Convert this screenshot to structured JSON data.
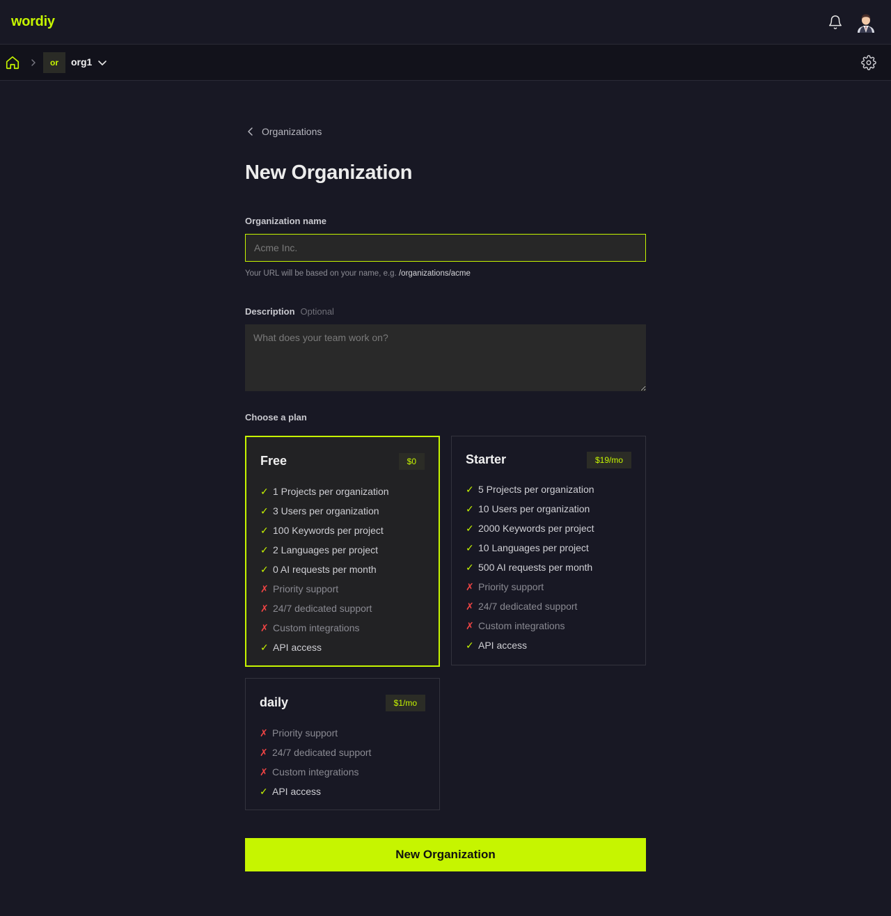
{
  "app": {
    "logo": "wordiy"
  },
  "breadcrumb": {
    "org_badge": "or",
    "org_name": "org1"
  },
  "back_link": "Organizations",
  "page_title": "New Organization",
  "form": {
    "name_label": "Organization name",
    "name_placeholder": "Acme Inc.",
    "name_value": "",
    "hint_prefix": "Your URL will be based on your name, e.g. ",
    "hint_example": "/organizations/acme",
    "description_label": "Description",
    "description_optional": "Optional",
    "description_placeholder": "What does your team work on?",
    "description_value": "",
    "plan_label": "Choose a plan"
  },
  "plans": [
    {
      "name": "Free",
      "price": "$0",
      "selected": true,
      "features": [
        {
          "text": "1 Projects per organization",
          "included": true
        },
        {
          "text": "3 Users per organization",
          "included": true
        },
        {
          "text": "100 Keywords per project",
          "included": true
        },
        {
          "text": "2 Languages per project",
          "included": true
        },
        {
          "text": "0 AI requests per month",
          "included": true
        },
        {
          "text": "Priority support",
          "included": false
        },
        {
          "text": "24/7 dedicated support",
          "included": false
        },
        {
          "text": "Custom integrations",
          "included": false
        },
        {
          "text": "API access",
          "included": true
        }
      ]
    },
    {
      "name": "Starter",
      "price": "$19/mo",
      "selected": false,
      "features": [
        {
          "text": "5 Projects per organization",
          "included": true
        },
        {
          "text": "10 Users per organization",
          "included": true
        },
        {
          "text": "2000 Keywords per project",
          "included": true
        },
        {
          "text": "10 Languages per project",
          "included": true
        },
        {
          "text": "500 AI requests per month",
          "included": true
        },
        {
          "text": "Priority support",
          "included": false
        },
        {
          "text": "24/7 dedicated support",
          "included": false
        },
        {
          "text": "Custom integrations",
          "included": false
        },
        {
          "text": "API access",
          "included": true
        }
      ]
    },
    {
      "name": "daily",
      "price": "$1/mo",
      "selected": false,
      "features": [
        {
          "text": "Priority support",
          "included": false
        },
        {
          "text": "24/7 dedicated support",
          "included": false
        },
        {
          "text": "Custom integrations",
          "included": false
        },
        {
          "text": "API access",
          "included": true
        }
      ]
    }
  ],
  "marks": {
    "yes": "✓",
    "no": "✗"
  },
  "submit_label": "New Organization",
  "colors": {
    "accent": "#c6f500",
    "background": "#181824",
    "danger": "#ef4444"
  }
}
